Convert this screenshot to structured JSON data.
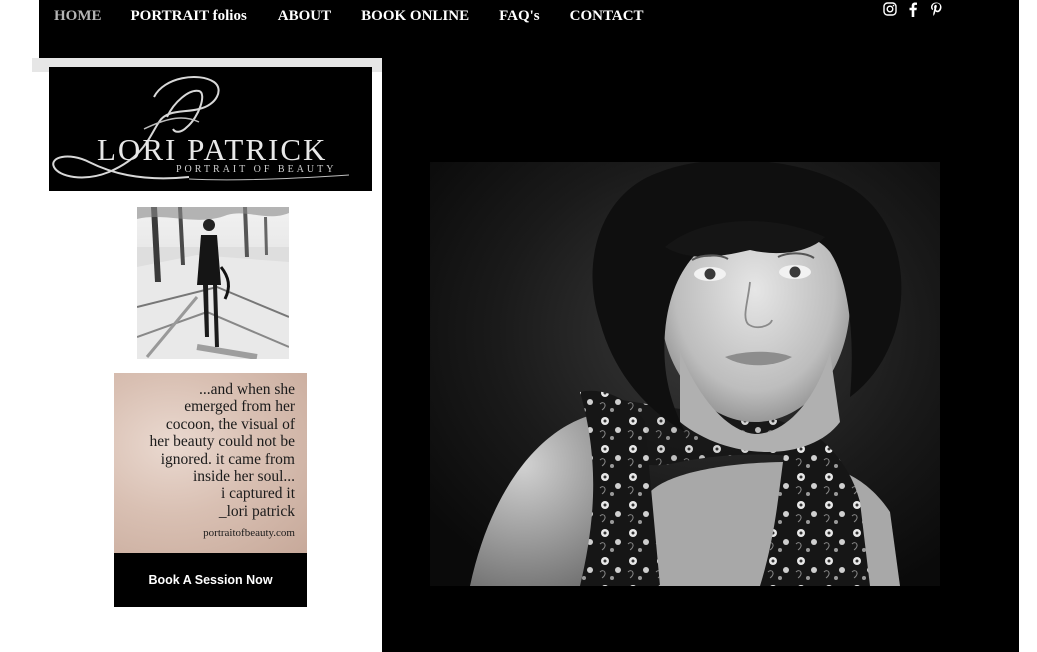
{
  "nav": {
    "items": [
      {
        "label": "HOME",
        "active": true
      },
      {
        "label": "PORTRAIT folios",
        "active": false
      },
      {
        "label": "ABOUT",
        "active": false
      },
      {
        "label": "BOOK ONLINE",
        "active": false
      },
      {
        "label": "FAQ's",
        "active": false
      },
      {
        "label": "CONTACT",
        "active": false
      }
    ]
  },
  "social": {
    "icons": [
      "instagram-icon",
      "facebook-icon",
      "pinterest-icon"
    ]
  },
  "logo": {
    "monogram": "LP",
    "brand": "LORI PATRICK",
    "tagline": "PORTRAIT OF BEAUTY"
  },
  "quote": {
    "lines": [
      "...and when she",
      "emerged from her",
      "cocoon, the visual of",
      "her beauty could not be",
      "ignored. it came from",
      "inside her soul...",
      "i captured it",
      "_lori patrick"
    ],
    "website": "portraitofbeauty.com"
  },
  "cta": {
    "book_label": "Book A Session Now"
  },
  "colors": {
    "background": "#ffffff",
    "header": "#000000",
    "nav_text": "#ffffff",
    "nav_active": "#b4b4b4",
    "quote_paper": "#d9c0b3"
  }
}
